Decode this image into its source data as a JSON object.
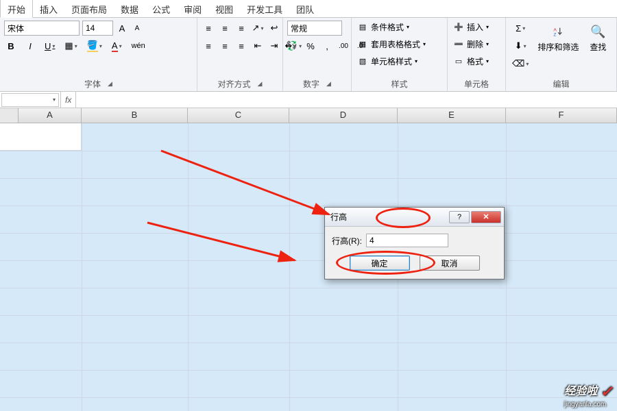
{
  "tabs": {
    "items": [
      "开始",
      "插入",
      "页面布局",
      "数据",
      "公式",
      "审阅",
      "视图",
      "开发工具",
      "团队"
    ],
    "active": 0
  },
  "ribbon": {
    "font": {
      "name": "宋体",
      "size": "14",
      "increase_tip": "A",
      "decrease_tip": "A",
      "bold": "B",
      "italic": "I",
      "underline": "U",
      "label": "字体"
    },
    "align": {
      "label": "对齐方式"
    },
    "number": {
      "format": "常规",
      "label": "数字"
    },
    "styles": {
      "cond": "条件格式",
      "table": "套用表格格式",
      "cell": "单元格样式",
      "label": "样式"
    },
    "cells": {
      "insert": "插入",
      "delete": "删除",
      "format": "格式",
      "label": "单元格"
    },
    "editing": {
      "sort": "排序和筛选",
      "find": "查找",
      "label": "编辑"
    }
  },
  "formula_bar": {
    "name_box": "",
    "fx": "fx",
    "value": ""
  },
  "columns": [
    "A",
    "B",
    "C",
    "D",
    "E",
    "F"
  ],
  "dialog": {
    "title": "行高",
    "field_label": "行高(R):",
    "field_value": "4",
    "ok": "确定",
    "cancel": "取消"
  },
  "watermark": {
    "main": "经验啦",
    "sub": "jingyanla.com"
  }
}
